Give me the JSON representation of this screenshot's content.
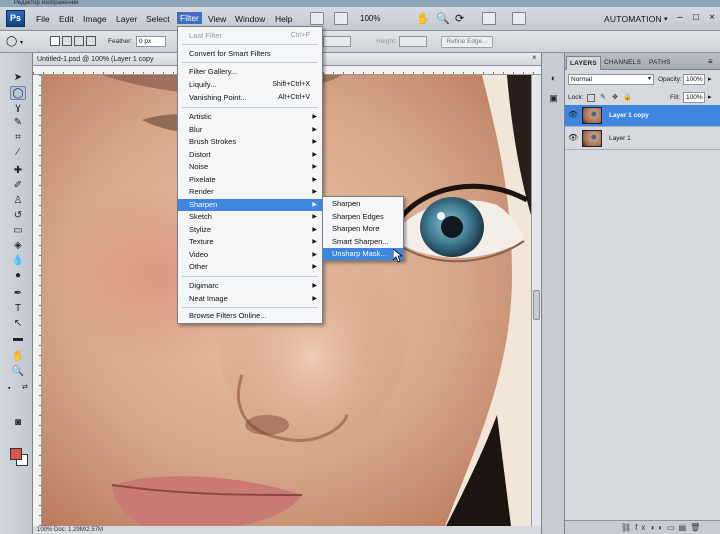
{
  "app": {
    "title": "Редактор изображений"
  },
  "menubar": {
    "logo": "Ps",
    "items": [
      "File",
      "Edit",
      "Image",
      "Layer",
      "Select",
      "Filter",
      "View",
      "Window",
      "Help"
    ],
    "zoom": "100%",
    "workspace": "AUTOMATION"
  },
  "options_bar": {
    "feather_label": "Feather:",
    "feather_value": "0 px",
    "height_label": "Height:",
    "refine_edge": "Refine Edge..."
  },
  "document": {
    "tab_title": "Untitled-1.psd @ 100% (Layer 1 copy",
    "tab_close": "×",
    "status": "100%      Doc: 1.29M/2.57M"
  },
  "filter_menu": {
    "last_filter": {
      "label": "Last Filter",
      "shortcut": "Ctrl+F"
    },
    "convert": "Convert for Smart Filters",
    "gallery": "Filter Gallery...",
    "liquify": {
      "label": "Liquify...",
      "shortcut": "Shift+Ctrl+X"
    },
    "vanishing": {
      "label": "Vanishing Point...",
      "shortcut": "Alt+Ctrl+V"
    },
    "groups": [
      "Artistic",
      "Blur",
      "Brush Strokes",
      "Distort",
      "Noise",
      "Pixelate",
      "Render",
      "Sharpen",
      "Sketch",
      "Stylize",
      "Texture",
      "Video",
      "Other"
    ],
    "plugins": [
      "Digimarc",
      "Neat Image"
    ],
    "browse": "Browse Filters Online..."
  },
  "sharpen_menu": {
    "items": [
      "Sharpen",
      "Sharpen Edges",
      "Sharpen More",
      "Smart Sharpen...",
      "Unsharp Mask..."
    ]
  },
  "layers_panel": {
    "tabs": [
      "LAYERS",
      "CHANNELS",
      "PATHS"
    ],
    "blend_mode": "Normal",
    "opacity_label": "Opacity:",
    "opacity_value": "100%",
    "lock_label": "Lock:",
    "fill_label": "Fill:",
    "fill_value": "100%",
    "layers": [
      {
        "name": "Layer 1 copy",
        "selected": true
      },
      {
        "name": "Layer 1",
        "selected": false
      }
    ]
  },
  "colors": {
    "foreground": "#d9574a",
    "background": "#ffffff",
    "highlight": "#3f86e0"
  }
}
